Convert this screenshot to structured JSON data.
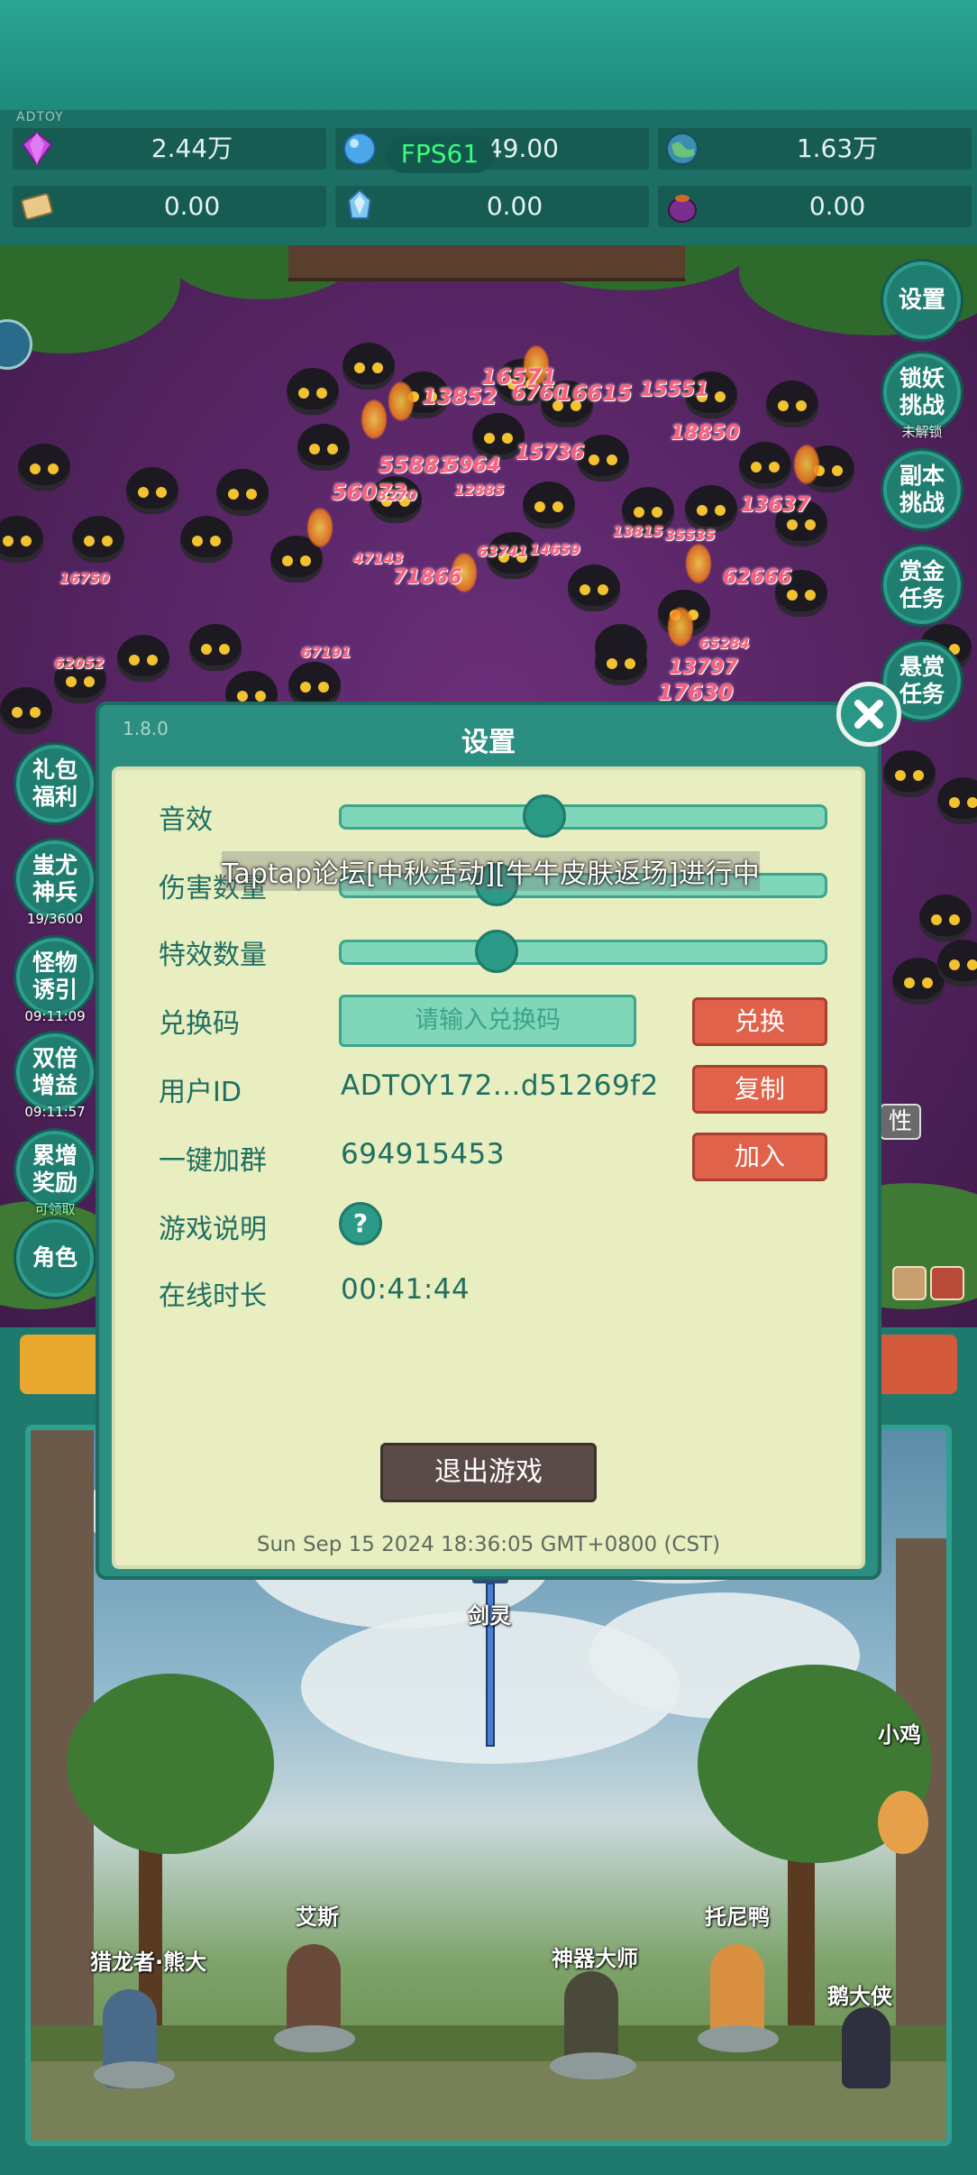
{
  "brand_tag": "ADTOY",
  "fps_label": "FPS61",
  "resources": [
    {
      "icon": "purple-gem-icon",
      "value": "2.44万"
    },
    {
      "icon": "blue-crystal-orb-icon",
      "value": "149.00"
    },
    {
      "icon": "earth-globe-icon",
      "value": "1.63万"
    },
    {
      "icon": "scroll-icon",
      "value": "0.00"
    },
    {
      "icon": "ice-crystal-icon",
      "value": "0.00"
    },
    {
      "icon": "magic-pot-icon",
      "value": "0.00"
    }
  ],
  "right_menu": [
    {
      "label": "设置"
    },
    {
      "label": "锁妖挑战",
      "sub": "未解锁"
    },
    {
      "label": "副本挑战"
    },
    {
      "label": "赏金任务"
    },
    {
      "label": "悬赏任务"
    }
  ],
  "left_menu": [
    {
      "label": "礼包福利"
    },
    {
      "label": "蚩尤神兵",
      "sub": "19/3600"
    },
    {
      "label": "怪物诱引",
      "sub": "09:11:09"
    },
    {
      "label": "双倍增益",
      "sub": "09:11:57"
    },
    {
      "label": "累增奖励",
      "sub": "可领取"
    },
    {
      "label": "角色"
    }
  ],
  "attr_tag": "性",
  "damage_numbers": [
    "16571",
    "13852",
    "6760",
    "16615",
    "15551",
    "18850",
    "55881",
    "5964",
    "15736",
    "56073",
    "8270",
    "12885",
    "13637",
    "47143",
    "63741",
    "14659",
    "71866",
    "16750",
    "13815",
    "35535",
    "62666",
    "65284",
    "62052",
    "67191",
    "13797",
    "17630"
  ],
  "settings": {
    "version": "1.8.0",
    "title": "设置",
    "sound_label": "音效",
    "sound_level": 0.42,
    "damage_count_label": "伤害数量",
    "damage_count_level": 0.32,
    "effects_count_label": "特效数量",
    "effects_count_level": 0.32,
    "redeem_label": "兑换码",
    "redeem_placeholder": "请输入兑换码",
    "redeem_button": "兑换",
    "user_id_label": "用户ID",
    "user_id_value": "ADTOY172...d51269f2",
    "copy_button": "复制",
    "join_group_label": "一键加群",
    "group_number": "694915453",
    "join_button": "加入",
    "guide_label": "游戏说明",
    "help_symbol": "?",
    "online_label": "在线时长",
    "online_time": "00:41:44",
    "exit_button": "退出游戏",
    "timestamp": "Sun Sep 15 2024 18:36:05 GMT+0800 (CST)"
  },
  "marquee_text": "Taptap论坛[中秋活动][牛牛皮肤返场]进行中",
  "heroes": [
    {
      "name": "剑灵"
    },
    {
      "name": "小鸡"
    },
    {
      "name": "艾斯"
    },
    {
      "name": "托尼鸭"
    },
    {
      "name": "猎龙者·熊大"
    },
    {
      "name": "神器大师"
    },
    {
      "name": "鹅大侠"
    }
  ],
  "colors": {
    "teal": "#1f7a6e",
    "panel": "#e8eec0",
    "orange_button": "#e0624a",
    "slider_fill": "#7fd6b8"
  }
}
